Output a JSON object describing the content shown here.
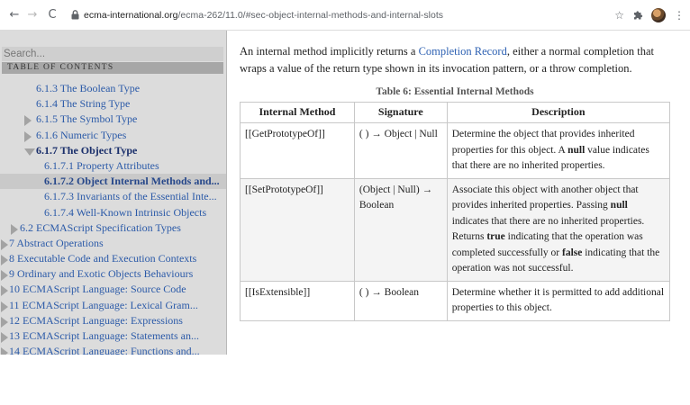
{
  "browser": {
    "back_glyph": "←",
    "forward_glyph": "→",
    "reload_glyph": "C",
    "url_host": "ecma-international.org",
    "url_path": "/ecma-262/11.0/#sec-object-internal-methods-and-internal-slots",
    "icons": [
      "lock-icon",
      "star-icon",
      "extensions-puzzle-icon",
      "profile-avatar",
      "kebab-menu-icon"
    ]
  },
  "sidebar": {
    "search_placeholder": "Search...",
    "toc_title": "TABLE OF CONTENTS",
    "items": [
      {
        "label": "6.1.3 The Boolean Type",
        "indent": 1,
        "marker": "none",
        "state": "normal"
      },
      {
        "label": "6.1.4 The String Type",
        "indent": 1,
        "marker": "none",
        "state": "normal"
      },
      {
        "label": "6.1.5 The Symbol Type",
        "indent": 1,
        "marker": "collapsed",
        "state": "normal"
      },
      {
        "label": "6.1.6 Numeric Types",
        "indent": 1,
        "marker": "collapsed",
        "state": "normal"
      },
      {
        "label": "6.1.7 The Object Type",
        "indent": 1,
        "marker": "expanded",
        "state": "active"
      },
      {
        "label": "6.1.7.1 Property Attributes",
        "indent": 2,
        "marker": "none",
        "state": "normal"
      },
      {
        "label": "6.1.7.2 Object Internal Methods and...",
        "indent": 2,
        "marker": "none",
        "state": "current"
      },
      {
        "label": "6.1.7.3 Invariants of the Essential Inte...",
        "indent": 2,
        "marker": "none",
        "state": "normal"
      },
      {
        "label": "6.1.7.4 Well-Known Intrinsic Objects",
        "indent": 2,
        "marker": "none",
        "state": "normal"
      },
      {
        "label": "6.2 ECMAScript Specification Types",
        "indent": 0,
        "marker": "collapsed",
        "state": "normal"
      },
      {
        "label": "7 Abstract Operations",
        "indent": -1,
        "marker": "collapsed",
        "state": "normal"
      },
      {
        "label": "8 Executable Code and Execution Contexts",
        "indent": -1,
        "marker": "collapsed",
        "state": "normal"
      },
      {
        "label": "9 Ordinary and Exotic Objects Behaviours",
        "indent": -1,
        "marker": "collapsed",
        "state": "normal"
      },
      {
        "label": "10 ECMAScript Language: Source Code",
        "indent": -1,
        "marker": "collapsed",
        "state": "normal"
      },
      {
        "label": "11 ECMAScript Language: Lexical Gram...",
        "indent": -1,
        "marker": "collapsed",
        "state": "normal"
      },
      {
        "label": "12 ECMAScript Language: Expressions",
        "indent": -1,
        "marker": "collapsed",
        "state": "normal"
      },
      {
        "label": "13 ECMAScript Language: Statements an...",
        "indent": -1,
        "marker": "collapsed",
        "state": "normal"
      },
      {
        "label": "14 ECMAScript Language: Functions and...",
        "indent": -1,
        "marker": "collapsed",
        "state": "normal"
      }
    ]
  },
  "main": {
    "intro_before": "An internal method implicitly returns a ",
    "intro_link": "Completion Record",
    "intro_after": ", either a normal completion that wraps a value of the return type shown in its invocation pattern, or a throw completion.",
    "table_caption": "Table 6: Essential Internal Methods",
    "headers": [
      "Internal Method",
      "Signature",
      "Description"
    ],
    "rows": [
      {
        "method": "[[GetPrototypeOf]]",
        "signature": "( ) → Object | Null",
        "description": [
          {
            "t": "Determine the object that provides inherited properties for this object. A ",
            "b": false
          },
          {
            "t": "null",
            "b": true
          },
          {
            "t": " value indicates that there are no inherited properties.",
            "b": false
          }
        ]
      },
      {
        "method": "[[SetPrototypeOf]]",
        "signature": "(Object | Null) → Boolean",
        "description": [
          {
            "t": "Associate this object with another object that provides inherited properties. Passing ",
            "b": false
          },
          {
            "t": "null",
            "b": true
          },
          {
            "t": " indicates that there are no inherited properties. Returns ",
            "b": false
          },
          {
            "t": "true",
            "b": true
          },
          {
            "t": " indicating that the operation was completed successfully or ",
            "b": false
          },
          {
            "t": "false",
            "b": true
          },
          {
            "t": " indicating that the operation was not successful.",
            "b": false
          }
        ]
      },
      {
        "method": "[[IsExtensible]]",
        "signature": "( ) → Boolean",
        "description": [
          {
            "t": "Determine whether it is permitted to add additional properties to this object.",
            "b": false
          }
        ]
      }
    ]
  }
}
